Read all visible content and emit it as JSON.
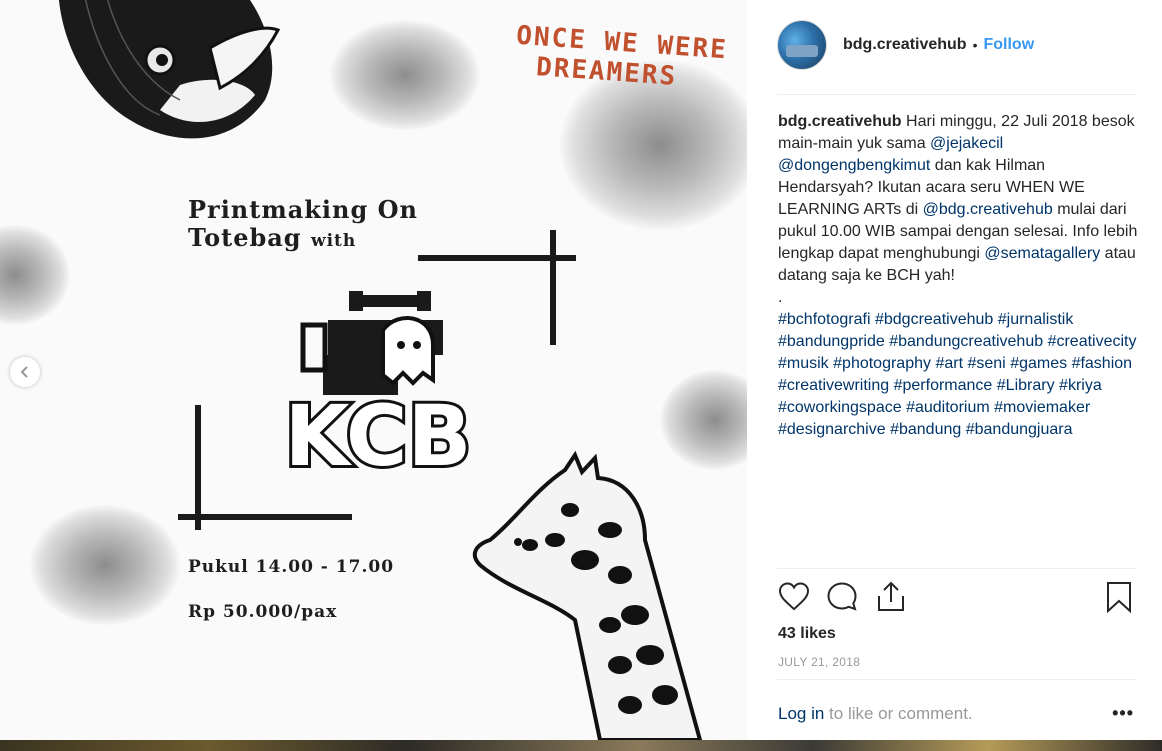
{
  "poster": {
    "scribble_line1": "ONCE WE WERE",
    "scribble_line2": "DREAMERS",
    "title_line1": "Printmaking On",
    "title_line2": "Totebag",
    "title_with": "with",
    "logo_letters": "KCB",
    "time": "Pukul 14.00 - 17.00",
    "price": "Rp 50.000/pax"
  },
  "header": {
    "username": "bdg.creativehub",
    "separator": "•",
    "follow_label": "Follow"
  },
  "caption": {
    "username": "bdg.creativehub",
    "t1": "Hari minggu, 22 Juli 2018 besok main-main yuk sama ",
    "m1": "@jejakecil",
    "m2": "@dongengbengkimut",
    "t2": " dan kak Hilman Hendarsyah? Ikutan acara seru WHEN WE LEARNING ARTs di ",
    "m3": "@bdg.creativehub",
    "t3": " mulai dari pukul 10.00 WIB sampai dengan selesai. Info lebih lengkap dapat menghubungi ",
    "m4": "@sematagallery",
    "t4": " atau datang saja ke BCH yah!",
    "dot": ".",
    "hashtags": [
      "#bchfotografi",
      "#bdgcreativehub",
      "#jurnalistik",
      "#bandungpride",
      "#bandungcreativehub",
      "#creativecity",
      "#musik",
      "#photography",
      "#art",
      "#seni",
      "#games",
      "#fashion",
      "#creativewriting",
      "#performance",
      "#Library",
      "#kriya",
      "#coworkingspace",
      "#auditorium",
      "#moviemaker",
      "#designarchive",
      "#bandung",
      "#bandungjuara"
    ]
  },
  "actions": {
    "like_icon": "heart-icon",
    "comment_icon": "comment-icon",
    "share_icon": "share-icon",
    "save_icon": "bookmark-icon"
  },
  "likes": "43 likes",
  "date": "JULY 21, 2018",
  "comment_bar": {
    "login_label": "Log in",
    "rest": " to like or comment.",
    "more_label": "•••"
  },
  "colors": {
    "link": "#003569",
    "follow": "#3897f0",
    "scribble": "#c0502e"
  }
}
